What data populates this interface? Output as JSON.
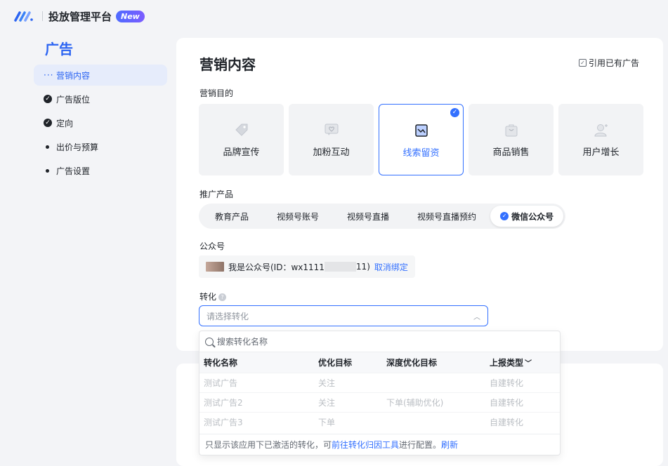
{
  "header": {
    "title": "投放管理平台",
    "badge": "New"
  },
  "sidebar": {
    "title": "广告",
    "items": [
      {
        "label": "营销内容",
        "state": "active"
      },
      {
        "label": "广告版位",
        "state": "done"
      },
      {
        "label": "定向",
        "state": "done"
      },
      {
        "label": "出价与预算",
        "state": "todo"
      },
      {
        "label": "广告设置",
        "state": "todo"
      }
    ]
  },
  "main": {
    "title": "营销内容",
    "cite_link": "引用已有广告",
    "goal_label": "营销目的",
    "goals": [
      {
        "label": "品牌宣传",
        "icon": "tag-icon"
      },
      {
        "label": "加粉互动",
        "icon": "heart-chat-icon"
      },
      {
        "label": "线索留资",
        "icon": "leads-icon",
        "selected": true
      },
      {
        "label": "商品销售",
        "icon": "shopping-bag-icon"
      },
      {
        "label": "用户增长",
        "icon": "user-add-icon"
      }
    ],
    "product_label": "推广产品",
    "products": [
      "教育产品",
      "视频号账号",
      "视频号直播",
      "视频号直播预约",
      "微信公众号"
    ],
    "selected_product": "微信公众号",
    "account_label": "公众号",
    "account": {
      "text_prefix": "我是公众号(ID：wx1111",
      "text_suffix": "11)",
      "unbind": "取消绑定"
    },
    "conversion_label": "转化",
    "conversion_placeholder": "请选择转化"
  },
  "dropdown": {
    "search_placeholder": "搜索转化名称",
    "columns": [
      "转化名称",
      "优化目标",
      "深度优化目标",
      "上报类型"
    ],
    "rows": [
      [
        "测试广告",
        "关注",
        "",
        "自建转化"
      ],
      [
        "测试广告2",
        "关注",
        "下单(辅助优化)",
        "自建转化"
      ],
      [
        "测试广告3",
        "下单",
        "",
        "自建转化"
      ]
    ],
    "footer_prefix": "只显示该应用下已激活的转化，可",
    "footer_link": "前往转化归因工具",
    "footer_mid": "进行配置。",
    "footer_refresh": "刷新"
  },
  "colors": {
    "accent": "#3370ff",
    "sidebar_active_bg": "#e6ecfb"
  }
}
